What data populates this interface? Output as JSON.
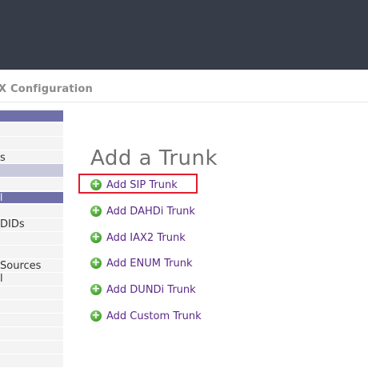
{
  "header": {
    "config_title": "X Configuration"
  },
  "sidebar": {
    "items": [
      {
        "label": "",
        "kind": "header"
      },
      {
        "label": "",
        "kind": "row"
      },
      {
        "label": "",
        "kind": "row"
      },
      {
        "label": "s",
        "kind": "row"
      },
      {
        "label": "",
        "kind": "selected"
      },
      {
        "label": "",
        "kind": "row"
      },
      {
        "label": "l",
        "kind": "header"
      },
      {
        "label": "",
        "kind": "row"
      },
      {
        "label": "DIDs",
        "kind": "row"
      },
      {
        "label": "",
        "kind": "row"
      },
      {
        "label": "",
        "kind": "row"
      },
      {
        "label": "Sources",
        "kind": "row"
      },
      {
        "label": "l",
        "kind": "row"
      },
      {
        "label": "",
        "kind": "row"
      },
      {
        "label": "",
        "kind": "row"
      },
      {
        "label": "",
        "kind": "row"
      },
      {
        "label": "",
        "kind": "row"
      },
      {
        "label": "",
        "kind": "row"
      },
      {
        "label": "",
        "kind": "row"
      }
    ]
  },
  "main": {
    "heading": "Add a Trunk",
    "links": [
      {
        "label": "Add SIP Trunk",
        "icon": "add-circle-icon",
        "highlighted": true
      },
      {
        "label": "Add DAHDi Trunk",
        "icon": "add-circle-icon"
      },
      {
        "label": "Add IAX2 Trunk",
        "icon": "add-circle-icon"
      },
      {
        "label": "Add ENUM Trunk",
        "icon": "add-circle-icon"
      },
      {
        "label": "Add DUNDi Trunk",
        "icon": "add-circle-icon"
      },
      {
        "label": "Add Custom Trunk",
        "icon": "add-circle-icon"
      }
    ]
  },
  "colors": {
    "topbar": "#373d48",
    "sidebar_header": "#7070a8",
    "link": "#5b2a86",
    "highlight": "#e01e2e",
    "icon_green": "#4ea638"
  }
}
